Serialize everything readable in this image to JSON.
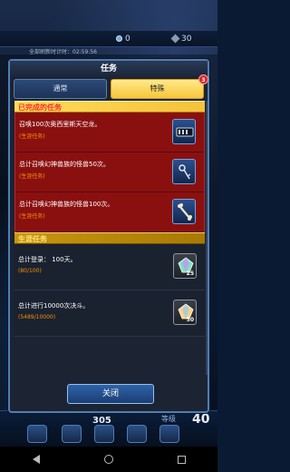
{
  "background": {
    "refresh_text": "全部刷新时计时：02:59:56",
    "gem_count": "0",
    "coin_count": "30",
    "bottom_number": "305",
    "bottom_number_right": "40",
    "rank_label": "等级"
  },
  "dialog": {
    "title": "任务",
    "tabs": [
      {
        "label": "通常",
        "active": false
      },
      {
        "label": "特殊",
        "active": true,
        "badge": "3"
      }
    ],
    "completed_section": {
      "label": "已完成的任务",
      "tasks": [
        {
          "title": "召唤100次奥西里斯天空龙。",
          "subtitle": "(生涯任务)",
          "reward_icon": "deck-case-icon"
        },
        {
          "title": "总计召唤幻神兽族的怪兽50次。",
          "subtitle": "(生涯任务)",
          "reward_icon": "key-icon"
        },
        {
          "title": "总计召唤幻神兽族的怪兽100次。",
          "subtitle": "(生涯任务)",
          "reward_icon": "bone-icon"
        }
      ]
    },
    "career_section": {
      "label": "生涯任务",
      "tasks": [
        {
          "title": "总计登录： 100天。",
          "progress": "(80/100)",
          "reward_icon": "crystal-icon",
          "reward_qty": "25"
        },
        {
          "title": "总计进行10000次决斗。",
          "progress": "(5489/10000)",
          "reward_icon": "crystal-icon",
          "reward_qty": "50"
        }
      ]
    },
    "close_label": "关闭"
  },
  "colors": {
    "completed_bg": "#8a1010",
    "section_done": "#f5c23a",
    "active_tab": "#f6c63a",
    "subtitle_orange": "#ff8f00"
  }
}
